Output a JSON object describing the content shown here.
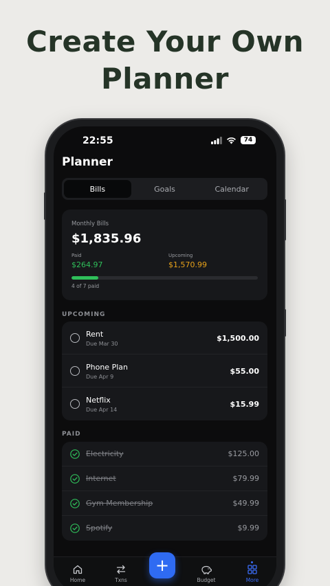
{
  "headline": {
    "line1": "Create Your Own",
    "line2": "Planner"
  },
  "status_bar": {
    "time": "22:55",
    "battery": "74"
  },
  "page_title": "Planner",
  "tabs": [
    {
      "label": "Bills",
      "active": true
    },
    {
      "label": "Goals",
      "active": false
    },
    {
      "label": "Calendar",
      "active": false
    }
  ],
  "summary": {
    "label": "Monthly Bills",
    "total": "$1,835.96",
    "paid_label": "Paid",
    "paid_value": "$264.97",
    "upcoming_label": "Upcoming",
    "upcoming_value": "$1,570.99",
    "progress_fraction": 0.143,
    "progress_text": "4 of 7 paid"
  },
  "upcoming": {
    "heading": "UPCOMING",
    "items": [
      {
        "name": "Rent",
        "due": "Due Mar 30",
        "amount": "$1,500.00"
      },
      {
        "name": "Phone Plan",
        "due": "Due Apr 9",
        "amount": "$55.00"
      },
      {
        "name": "Netflix",
        "due": "Due Apr 14",
        "amount": "$15.99"
      }
    ]
  },
  "paid": {
    "heading": "PAID",
    "items": [
      {
        "name": "Electricity",
        "amount": "$125.00"
      },
      {
        "name": "Internet",
        "amount": "$79.99"
      },
      {
        "name": "Gym Membership",
        "amount": "$49.99"
      },
      {
        "name": "Spotify",
        "amount": "$9.99"
      }
    ]
  },
  "bottom_nav": {
    "home": "Home",
    "txns": "Txns",
    "budget": "Budget",
    "more": "More",
    "active": "More"
  },
  "colors": {
    "accent": "#2f6bf2",
    "paid_green": "#2fbf5a",
    "upcoming_orange": "#e8a21a",
    "headline": "#253427"
  }
}
